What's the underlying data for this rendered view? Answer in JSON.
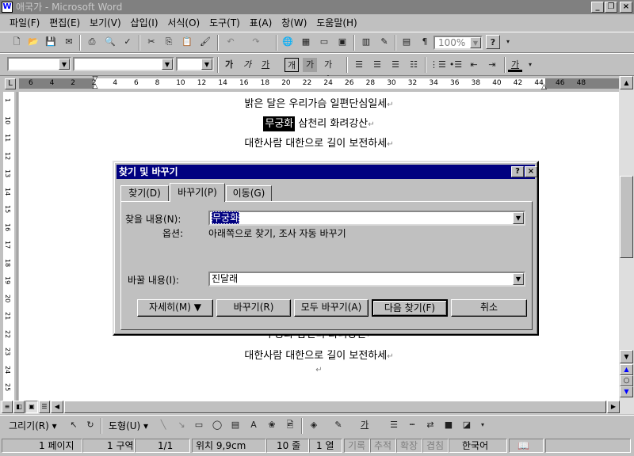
{
  "window": {
    "title": "애국가 - Microsoft Word",
    "app_icon": "W"
  },
  "menu": [
    "파일(F)",
    "편집(E)",
    "보기(V)",
    "삽입(I)",
    "서식(O)",
    "도구(T)",
    "표(A)",
    "창(W)",
    "도움말(H)"
  ],
  "toolbar": {
    "zoom": "100%"
  },
  "format_bar": {
    "bold": "가",
    "italic": "가",
    "underline": "가",
    "border_char": "개",
    "shade_char": "가",
    "font_color": "가"
  },
  "ruler": {
    "ticks": [
      "6",
      "4",
      "2",
      "2",
      "4",
      "6",
      "8",
      "10",
      "12",
      "14",
      "16",
      "18",
      "20",
      "22",
      "24",
      "26",
      "28",
      "30",
      "32",
      "34",
      "36",
      "38",
      "40",
      "42",
      "44",
      "46",
      "48"
    ]
  },
  "vruler": {
    "ticks": [
      "1",
      "10",
      "11",
      "12",
      "13",
      "14",
      "15",
      "16",
      "17",
      "18",
      "19",
      "20",
      "21",
      "22",
      "23",
      "24",
      "25"
    ]
  },
  "document": {
    "line1": "밝은 달은 우리가슴 일편단심일세",
    "line2_highlight": "무궁화",
    "line2_rest": " 삼천리 화려강산",
    "line3": "대한사람 대한으로 길이 보전하세",
    "line4": "무궁화 삼천리 화려강산",
    "line5": "대한사람 대한으로 길이 보전하세",
    "pilcrow": "↵"
  },
  "dialog": {
    "title": "찾기 및 바꾸기",
    "help_btn": "?",
    "close_btn": "×",
    "tabs": [
      "찾기(D)",
      "바꾸기(P)",
      "이동(G)"
    ],
    "find_label": "찾을 내용(N):",
    "find_value": "무궁화",
    "options_label": "옵션:",
    "options_value": "아래쪽으로 찾기, 조사 자동 바꾸기",
    "replace_label": "바꿀 내용(I):",
    "replace_value": "진달래",
    "buttons": {
      "more": "자세히(M) ▼",
      "replace": "바꾸기(R)",
      "replace_all": "모두 바꾸기(A)",
      "find_next": "다음 찾기(F)",
      "cancel": "취소"
    }
  },
  "draw_toolbar": {
    "draw": "그리기(R)",
    "autoshapes": "도형(U)"
  },
  "status": {
    "page": "1 페이지",
    "section": "1 구역",
    "pages": "1/1",
    "position": "위치 9,9cm",
    "line": "10 줄",
    "col": "1 열",
    "rec": "기록",
    "trk": "추적",
    "ext": "확장",
    "ovr": "겹침",
    "lang": "한국어"
  }
}
